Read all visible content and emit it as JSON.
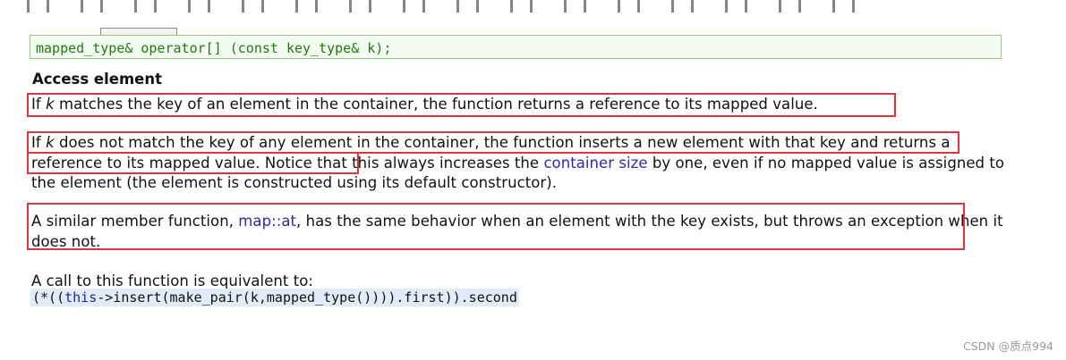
{
  "prototype": "mapped_type& operator[] (const key_type& k);",
  "heading": "Access element",
  "para1": {
    "t1": "If ",
    "k": "k",
    "t2": " matches the key of an element in the container, the function returns a reference to its mapped value."
  },
  "para2": {
    "t1": "If ",
    "k": "k",
    "t2": " does not match the key of any element in the container, the function inserts a new element with that key and returns a reference to its mapped value. Notice that this always increases the ",
    "link": "container size",
    "t3": " by one, even if no mapped value is assigned to the element (the element is constructed using its default constructor)."
  },
  "para3": {
    "t1": "A similar member function, ",
    "link": "map::at",
    "t2": ", has the same behavior when an element with the key exists, but throws an exception when it does not."
  },
  "para4": "A call to this function is equivalent to:",
  "equivalent_code": {
    "open": "(*((",
    "kw": "this",
    "rest": "->insert(make_pair(k,mapped_type()))).first)).second"
  },
  "watermark": "CSDN @质点994",
  "colors": {
    "highlight_box": "#e0353a",
    "link": "#2b2ba8",
    "code_green": "#1f7a12"
  }
}
